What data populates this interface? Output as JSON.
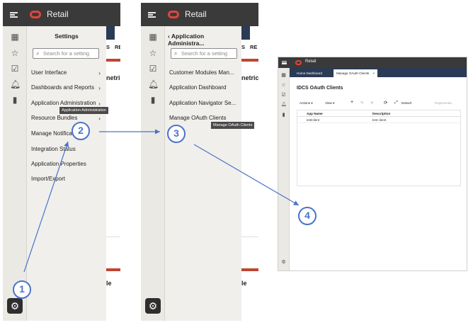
{
  "brand": {
    "app_title": "Retail",
    "accent": "#e0453a",
    "step_color": "#4a73c9"
  },
  "panel1": {
    "drawer_title": "Settings",
    "search_placeholder": "Search for a setting",
    "items": [
      {
        "label": "User Interface",
        "chevron": "›"
      },
      {
        "label": "Dashboards and Reports",
        "chevron": "›"
      },
      {
        "label": "Application Administration",
        "chevron": "›"
      },
      {
        "label": "Resource Bundles",
        "chevron": "›"
      },
      {
        "label": "Manage Notifications",
        "chevron": ""
      },
      {
        "label": "Integration Status",
        "chevron": ""
      },
      {
        "label": "Application Properties",
        "chevron": ""
      },
      {
        "label": "Import/Export",
        "chevron": ""
      }
    ],
    "tooltip": "Application Administration",
    "peek": {
      "tab_s": "S",
      "tab_re": "RE",
      "metric": "netric",
      "bottom": "le"
    }
  },
  "panel2": {
    "back_chevron": "‹",
    "drawer_title": "Application Administra...",
    "search_placeholder": "Search for a setting",
    "items": [
      {
        "label": "Customer Modules Man..."
      },
      {
        "label": "Application Dashboard"
      },
      {
        "label": "Application Navigator Se..."
      },
      {
        "label": "Manage OAuth Clients"
      }
    ],
    "tooltip": "Manage OAuth Clients",
    "peek": {
      "tab_s": "S",
      "tab_re": "RE",
      "metric": "netric",
      "bottom": "le"
    }
  },
  "panel3": {
    "app_title": "Retail",
    "tabs": [
      {
        "label": "Home Dashboard"
      },
      {
        "label": "Manage OAuth Clients",
        "close": "×"
      }
    ],
    "heading": "IDCS OAuth Clients",
    "toolbar": {
      "actions": "Actions ▾",
      "view": "View ▾",
      "add": "+",
      "edit": "✎",
      "delete": "✕",
      "refresh": "⟳",
      "detach_icon": "⤢",
      "detach": "Detach",
      "regenerate": "Regenerate"
    },
    "columns": [
      "App Name",
      "Description"
    ],
    "rows": [
      {
        "app_name": "testclient",
        "description": "test client"
      }
    ]
  },
  "steps": [
    "1",
    "2",
    "3",
    "4"
  ],
  "rail_icons": [
    "grid-icon",
    "star-icon",
    "calendar-check-icon",
    "bell-icon",
    "bar-chart-icon"
  ]
}
